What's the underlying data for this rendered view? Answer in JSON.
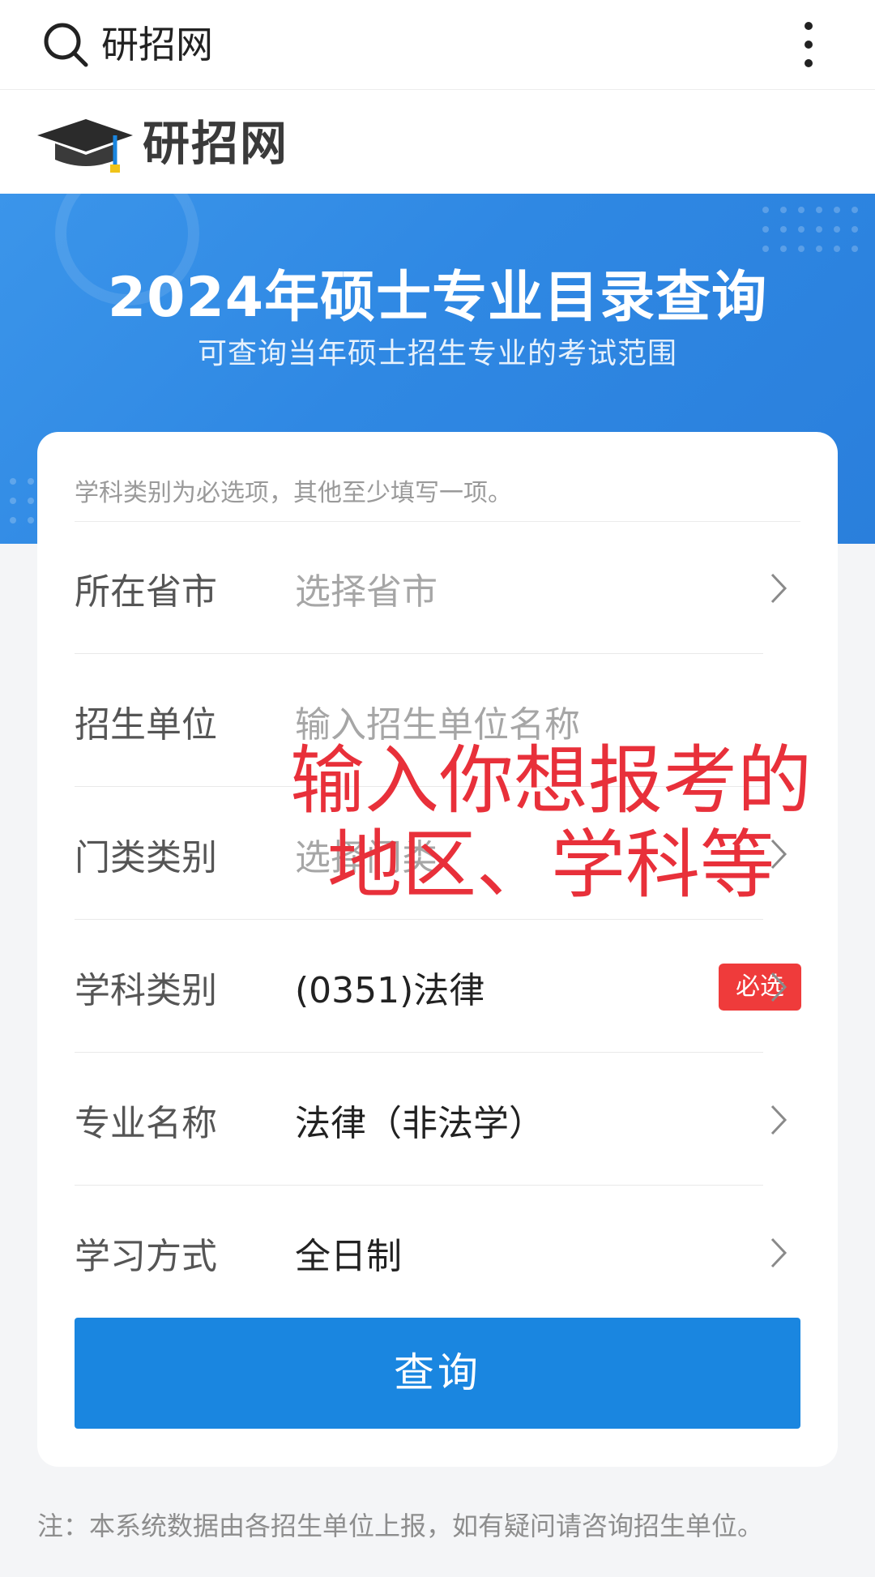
{
  "topbar": {
    "query": "研招网"
  },
  "site": {
    "logo_text": "研招网"
  },
  "banner": {
    "title": "2024年硕士专业目录查询",
    "subtitle": "可查询当年硕士招生专业的考试范围"
  },
  "form": {
    "hint": "学科类别为必选项，其他至少填写一项。",
    "rows": [
      {
        "label": "所在省市",
        "value": "选择省市"
      },
      {
        "label": "招生单位",
        "value": "输入招生单位名称"
      },
      {
        "label": "门类类别",
        "value": "选择门类"
      },
      {
        "label": "学科类别",
        "value": "(0351)法律",
        "badge": "必选"
      },
      {
        "label": "专业名称",
        "value": "法律（非法学）"
      },
      {
        "label": "学习方式",
        "value": "全日制"
      }
    ],
    "submit": "查询"
  },
  "overlay": {
    "line1": "输入你想报考的",
    "line2": "地区、学科等"
  },
  "footnote": "注：本系统数据由各招生单位上报，如有疑问请咨询招生单位。",
  "colors": {
    "primary": "#1a86e0",
    "badge": "#ef3b3b",
    "overlay": "#e8303a"
  }
}
